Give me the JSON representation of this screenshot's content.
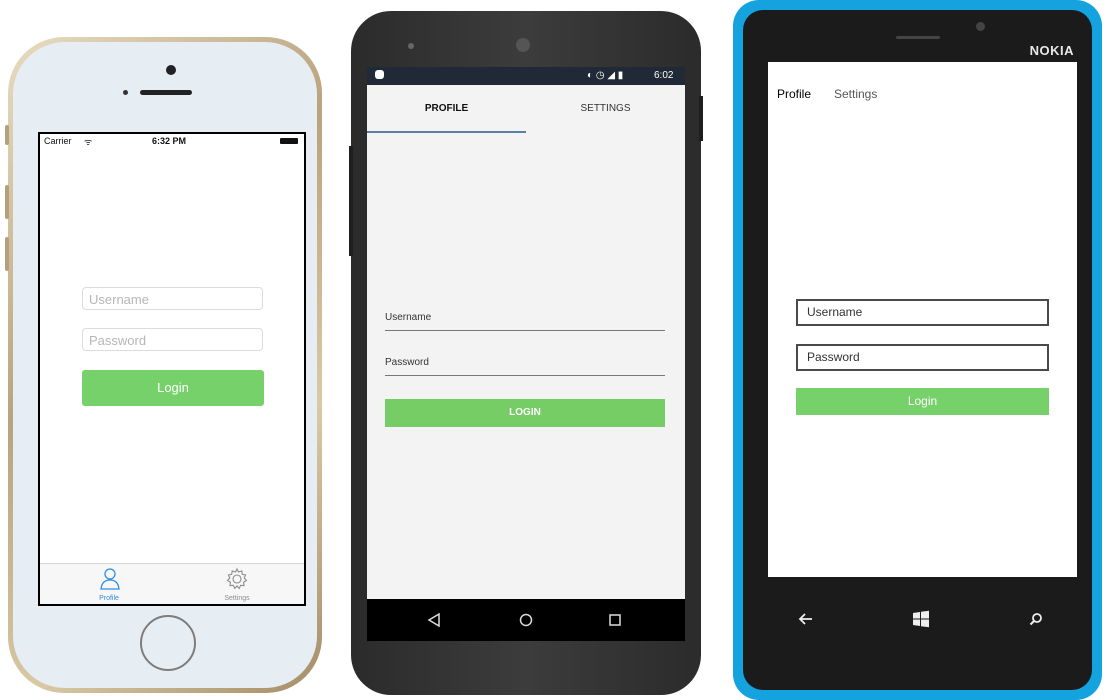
{
  "ios": {
    "status": {
      "carrier": "Carrier",
      "time": "6:32 PM"
    },
    "form": {
      "username_placeholder": "Username",
      "password_placeholder": "Password",
      "login_label": "Login"
    },
    "tabs": [
      {
        "label": "Profile",
        "active": true
      },
      {
        "label": "Settings",
        "active": false
      }
    ]
  },
  "android": {
    "status": {
      "time": "6:02"
    },
    "tabs": [
      {
        "label": "PROFILE",
        "active": true
      },
      {
        "label": "SETTINGS",
        "active": false
      }
    ],
    "form": {
      "username_placeholder": "Username",
      "password_placeholder": "Password",
      "login_label": "LOGIN"
    }
  },
  "windows": {
    "brand": "NOKIA",
    "pivot": [
      {
        "label": "Profile",
        "active": true
      },
      {
        "label": "Settings",
        "active": false
      }
    ],
    "form": {
      "username_placeholder": "Username",
      "password_placeholder": "Password",
      "login_label": "Login"
    }
  },
  "colors": {
    "login_green": "#76d16a",
    "ios_tint": "#2f8de4",
    "lumia_blue": "#15a3e0"
  }
}
